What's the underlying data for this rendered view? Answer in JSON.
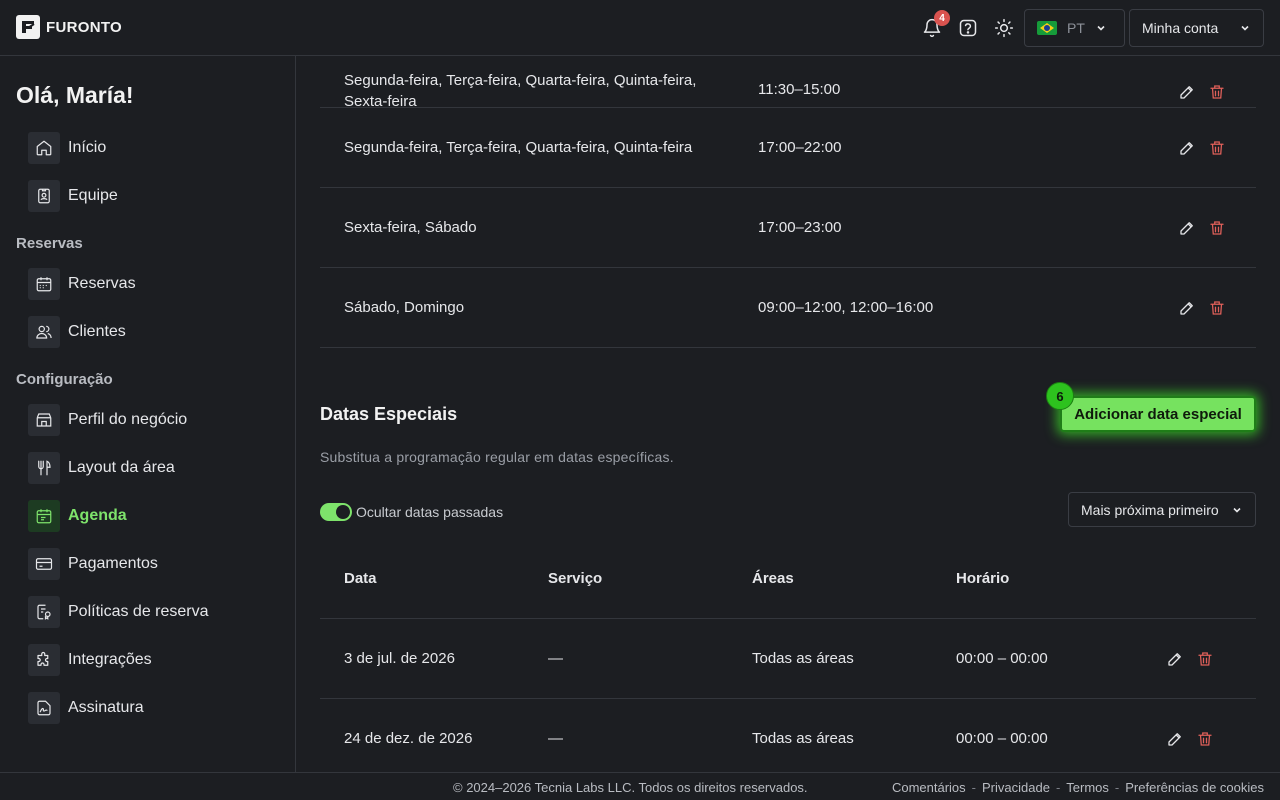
{
  "brand": {
    "name": "FURONTO"
  },
  "header": {
    "notifications_count": "4",
    "language": {
      "code": "PT",
      "flag": "brazil-flag"
    },
    "account_label": "Minha conta"
  },
  "sidebar": {
    "greeting": "Olá, María!",
    "items_top": [
      {
        "label": "Início",
        "icon": "home-icon"
      },
      {
        "label": "Equipe",
        "icon": "badge-icon"
      }
    ],
    "section_reservas": "Reservas",
    "items_reservas": [
      {
        "label": "Reservas",
        "icon": "calendar-icon"
      },
      {
        "label": "Clientes",
        "icon": "users-icon"
      }
    ],
    "section_config": "Configuração",
    "items_config": [
      {
        "label": "Perfil do negócio",
        "icon": "store-icon"
      },
      {
        "label": "Layout da área",
        "icon": "utensils-icon"
      },
      {
        "label": "Agenda",
        "icon": "calendar-clock-icon",
        "active": true
      },
      {
        "label": "Pagamentos",
        "icon": "credit-card-icon"
      },
      {
        "label": "Políticas de reserva",
        "icon": "policy-icon"
      },
      {
        "label": "Integrações",
        "icon": "puzzle-icon"
      },
      {
        "label": "Assinatura",
        "icon": "signature-icon"
      }
    ]
  },
  "schedule_rows": [
    {
      "days_line1": "Segunda-feira, Terça-feira, Quarta-feira, Quinta-feira,",
      "days_line2": "Sexta-feira",
      "time": "11:30–15:00"
    },
    {
      "days": "Segunda-feira, Terça-feira, Quarta-feira, Quinta-feira",
      "time": "17:00–22:00"
    },
    {
      "days": "Sexta-feira, Sábado",
      "time": "17:00–23:00"
    },
    {
      "days": "Sábado, Domingo",
      "time": "09:00–12:00, 12:00–16:00"
    }
  ],
  "special_dates": {
    "title": "Datas Especiais",
    "subtitle": "Substitua a programação regular em datas específicas.",
    "add_button": "Adicionar data especial",
    "step_badge": "6",
    "hide_past_label": "Ocultar datas passadas",
    "hide_past_enabled": true,
    "sort_value": "Mais próxima primeiro",
    "columns": [
      "Data",
      "Serviço",
      "Áreas",
      "Horário"
    ],
    "rows": [
      {
        "date": "3 de jul. de 2026",
        "service": "—",
        "areas": "Todas as áreas",
        "time": "00:00 – 00:00"
      },
      {
        "date": "24 de dez. de 2026",
        "service": "—",
        "areas": "Todas as áreas",
        "time": "00:00 – 00:00"
      }
    ]
  },
  "footer": {
    "copyright": "© 2024–2026 Tecnia Labs LLC. Todos os direitos reservados.",
    "links": [
      "Comentários",
      "Privacidade",
      "Termos",
      "Preferências de cookies"
    ],
    "separator": "-"
  },
  "colors": {
    "accent": "#7ee36b",
    "danger": "#e0605a",
    "background": "#1c1e22"
  }
}
